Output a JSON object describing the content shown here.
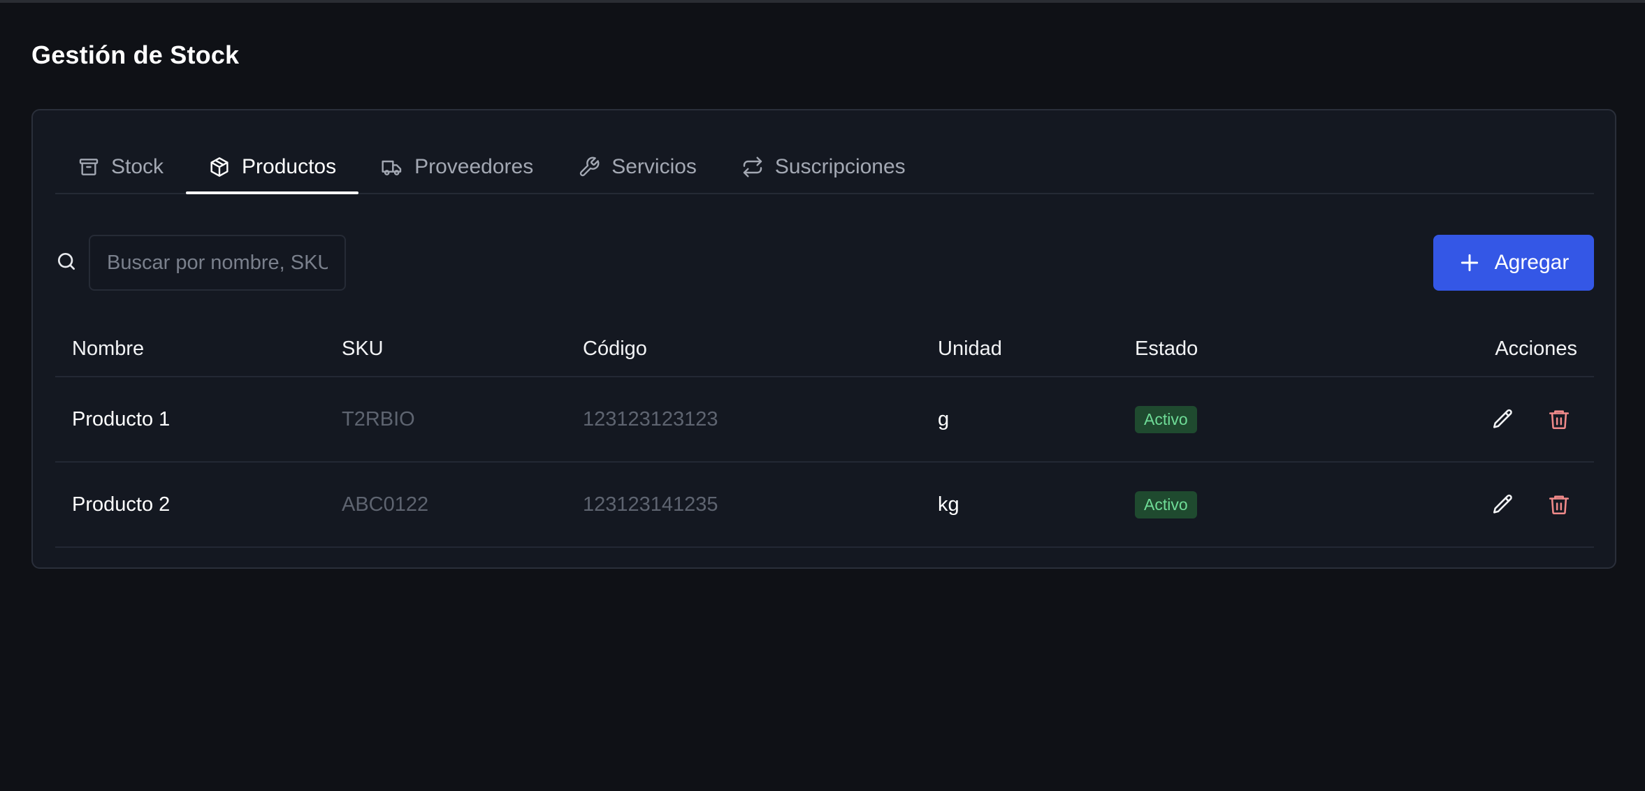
{
  "page": {
    "title": "Gestión de Stock"
  },
  "tabs": [
    {
      "label": "Stock",
      "icon": "archive-icon",
      "active": false
    },
    {
      "label": "Productos",
      "icon": "package-icon",
      "active": true
    },
    {
      "label": "Proveedores",
      "icon": "truck-icon",
      "active": false
    },
    {
      "label": "Servicios",
      "icon": "wrench-icon",
      "active": false
    },
    {
      "label": "Suscripciones",
      "icon": "repeat-icon",
      "active": false
    }
  ],
  "search": {
    "placeholder": "Buscar por nombre, SKU",
    "value": ""
  },
  "add_button": {
    "label": "Agregar"
  },
  "table": {
    "headers": {
      "nombre": "Nombre",
      "sku": "SKU",
      "codigo": "Código",
      "unidad": "Unidad",
      "estado": "Estado",
      "acciones": "Acciones"
    },
    "rows": [
      {
        "nombre": "Producto 1",
        "sku": "T2RBIO",
        "codigo": "123123123123",
        "unidad": "g",
        "estado": "Activo"
      },
      {
        "nombre": "Producto 2",
        "sku": "ABC0122",
        "codigo": "123123141235",
        "unidad": "kg",
        "estado": "Activo"
      }
    ]
  },
  "colors": {
    "accent": "#3457e6",
    "badge_bg": "#1f4a2f",
    "badge_text": "#6fdc97",
    "delete_icon": "#f08a8a"
  }
}
